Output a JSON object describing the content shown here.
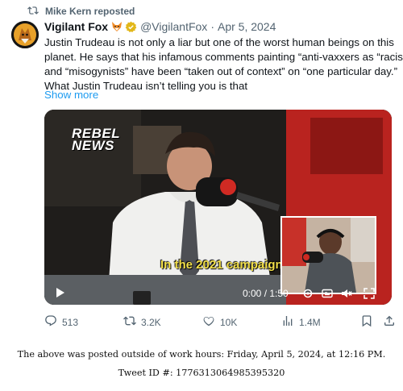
{
  "repost": {
    "icon": "repost-icon",
    "text": "Mike Kern reposted"
  },
  "tweet": {
    "author": {
      "display_name": "Vigilant Fox",
      "name_emoji": "fox-face-icon",
      "verified_badge": "verified-badge-icon",
      "handle": "@VigilantFox",
      "separator": "·",
      "date": "Apr 5, 2024"
    },
    "text_lines": [
      "Justin Trudeau is not only a liar but one of the worst human beings on this",
      "planet. He says that his infamous comments painting “anti-vaxxers as “racists”",
      "and “misogynists” have been “taken out of context” on “one particular day.”",
      "What Justin Trudeau isn’t telling you is that"
    ],
    "show_more": "Show more",
    "video": {
      "watermark_line1": "REBEL",
      "watermark_line2": "NEWS",
      "caption": "In the 2021 campaign.",
      "time": "0:00 / 1:50",
      "progress": 0.0,
      "icons": [
        "play-icon",
        "settings-icon",
        "captions-icon",
        "volume-icon",
        "fullscreen-icon"
      ]
    },
    "actions": {
      "replies": "513",
      "reposts": "3.2K",
      "likes": "10K",
      "views": "1.4M"
    }
  },
  "footer": {
    "posted_note": "The above was posted outside of work hours: Friday, April 5, 2024, at 12:16 PM.",
    "tweet_id": "Tweet ID #: 1776313064985395320"
  }
}
